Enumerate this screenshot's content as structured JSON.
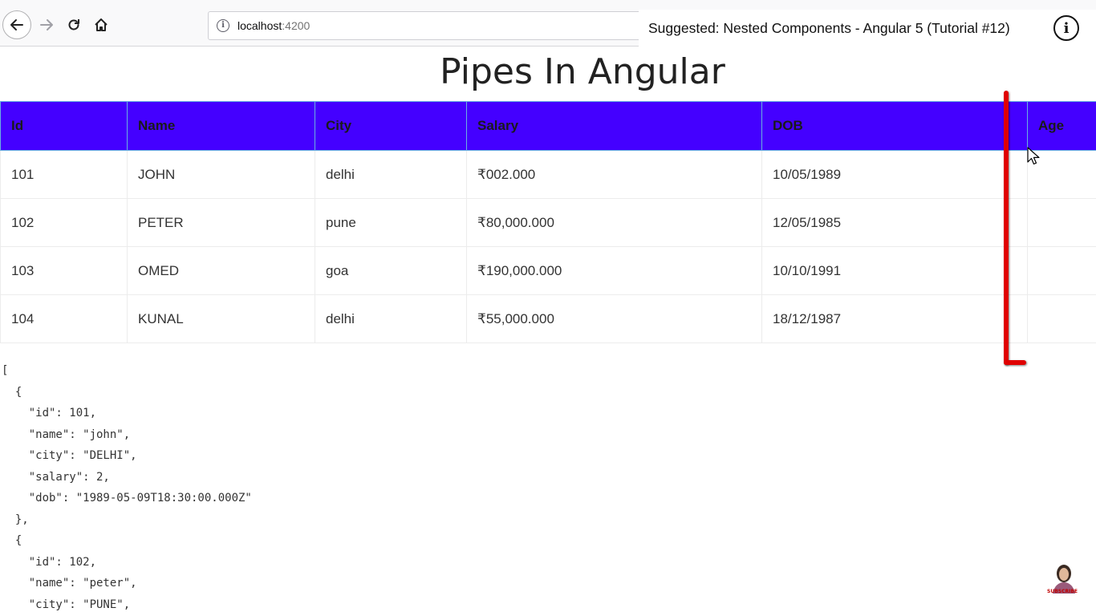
{
  "browser": {
    "url_host": "localhost",
    "url_port": ":4200"
  },
  "overlay": {
    "suggested_text": "Suggested: Nested Components - Angular 5 (Tutorial #12)"
  },
  "page": {
    "title": "Pipes In Angular"
  },
  "table": {
    "headers": [
      "Id",
      "Name",
      "City",
      "Salary",
      "DOB",
      "Age"
    ],
    "rows": [
      [
        "101",
        "JOHN",
        "delhi",
        "₹002.000",
        "10/05/1989",
        ""
      ],
      [
        "102",
        "PETER",
        "pune",
        "₹80,000.000",
        "12/05/1985",
        ""
      ],
      [
        "103",
        "OMED",
        "goa",
        "₹190,000.000",
        "10/10/1991",
        ""
      ],
      [
        "104",
        "KUNAL",
        "delhi",
        "₹55,000.000",
        "18/12/1987",
        ""
      ]
    ]
  },
  "json_output": "[\n  {\n    \"id\": 101,\n    \"name\": \"john\",\n    \"city\": \"DELHI\",\n    \"salary\": 2,\n    \"dob\": \"1989-05-09T18:30:00.000Z\"\n  },\n  {\n    \"id\": 102,\n    \"name\": \"peter\",\n    \"city\": \"PUNE\",",
  "subscribe": {
    "label": "SUBSCRIBE"
  },
  "colors": {
    "header_bg": "#4400ff",
    "marker": "#e00000"
  }
}
